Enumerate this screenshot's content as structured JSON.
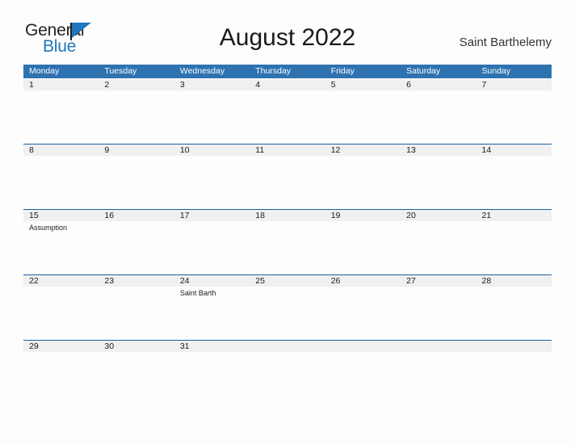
{
  "brand": {
    "name_part1": "General",
    "name_part2": "Blue",
    "flag_icon": "blue-flag-icon",
    "color_black": "#231f20",
    "color_blue": "#1f76bc"
  },
  "header": {
    "title": "August 2022",
    "region": "Saint Barthelemy"
  },
  "calendar": {
    "accent_color": "#2e72b0",
    "band_color": "#f0f0f0",
    "rule_color": "#1f5fa0",
    "weekdays": [
      "Monday",
      "Tuesday",
      "Wednesday",
      "Thursday",
      "Friday",
      "Saturday",
      "Sunday"
    ],
    "weeks": [
      {
        "band_columns": 7,
        "days": [
          {
            "number": "1",
            "events": []
          },
          {
            "number": "2",
            "events": []
          },
          {
            "number": "3",
            "events": []
          },
          {
            "number": "4",
            "events": []
          },
          {
            "number": "5",
            "events": []
          },
          {
            "number": "6",
            "events": []
          },
          {
            "number": "7",
            "events": []
          }
        ]
      },
      {
        "band_columns": 7,
        "days": [
          {
            "number": "8",
            "events": []
          },
          {
            "number": "9",
            "events": []
          },
          {
            "number": "10",
            "events": []
          },
          {
            "number": "11",
            "events": []
          },
          {
            "number": "12",
            "events": []
          },
          {
            "number": "13",
            "events": []
          },
          {
            "number": "14",
            "events": []
          }
        ]
      },
      {
        "band_columns": 7,
        "days": [
          {
            "number": "15",
            "events": [
              "Assumption"
            ]
          },
          {
            "number": "16",
            "events": []
          },
          {
            "number": "17",
            "events": []
          },
          {
            "number": "18",
            "events": []
          },
          {
            "number": "19",
            "events": []
          },
          {
            "number": "20",
            "events": []
          },
          {
            "number": "21",
            "events": []
          }
        ]
      },
      {
        "band_columns": 7,
        "days": [
          {
            "number": "22",
            "events": []
          },
          {
            "number": "23",
            "events": []
          },
          {
            "number": "24",
            "events": [
              "Saint Barth"
            ]
          },
          {
            "number": "25",
            "events": []
          },
          {
            "number": "26",
            "events": []
          },
          {
            "number": "27",
            "events": []
          },
          {
            "number": "28",
            "events": []
          }
        ]
      },
      {
        "band_columns": 7,
        "days": [
          {
            "number": "29",
            "events": []
          },
          {
            "number": "30",
            "events": []
          },
          {
            "number": "31",
            "events": []
          },
          {
            "number": "",
            "events": []
          },
          {
            "number": "",
            "events": []
          },
          {
            "number": "",
            "events": []
          },
          {
            "number": "",
            "events": []
          }
        ]
      }
    ]
  }
}
